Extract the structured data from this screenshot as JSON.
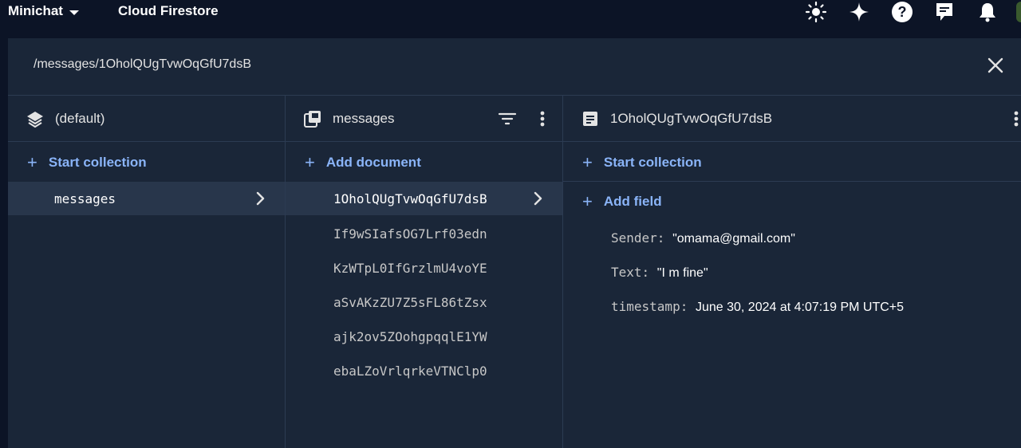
{
  "topbar": {
    "project_name": "Minichat",
    "product_title": "Cloud Firestore",
    "icons": [
      "theme-icon",
      "sparkle-icon",
      "help-icon",
      "feedback-icon",
      "notifications-icon"
    ]
  },
  "path": "/messages/1OholQUgTvwOqGfU7dsB",
  "columns": {
    "database": {
      "title": "(default)",
      "action": "Start collection",
      "items": [
        "messages"
      ]
    },
    "collection": {
      "title": "messages",
      "action": "Add document",
      "documents": [
        "1OholQUgTvwOqGfU7dsB",
        "If9wSIafsOG7Lrf03edn",
        "KzWTpL0IfGrzlmU4voYE",
        "aSvAKzZU7Z5sFL86tZsx",
        "ajk2ov5ZOohgpqqlE1YW",
        "ebaLZoVrlqrkeVTNClp0"
      ]
    },
    "document": {
      "title": "1OholQUgTvwOqGfU7dsB",
      "action_collection": "Start collection",
      "action_field": "Add field",
      "fields": [
        {
          "key": "Sender:",
          "value": "\"omama@gmail.com\""
        },
        {
          "key": "Text:",
          "value": "\"I m fine\""
        },
        {
          "key": "timestamp:",
          "value": "June 30, 2024 at 4:07:19 PM UTC+5"
        }
      ]
    }
  },
  "colors": {
    "accent": "#8ab4f8",
    "background": "#0c1426",
    "panel": "#1a2638",
    "selected_row": "#28364b"
  }
}
